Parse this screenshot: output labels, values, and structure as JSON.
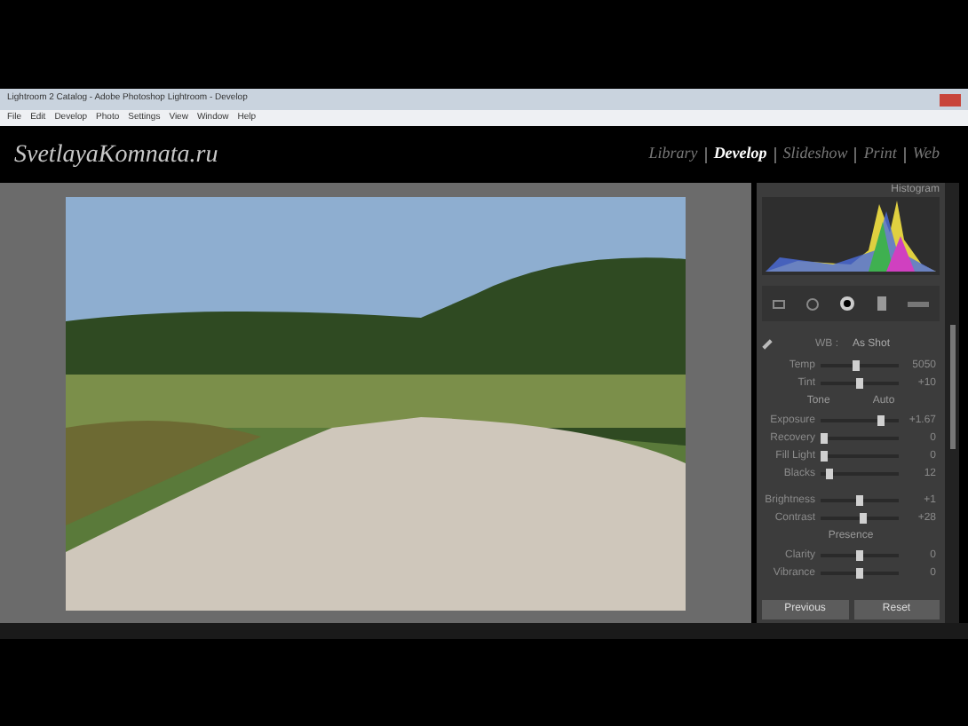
{
  "window": {
    "title": "Lightroom 2 Catalog - Adobe Photoshop Lightroom - Develop"
  },
  "menu": [
    "File",
    "Edit",
    "Develop",
    "Photo",
    "Settings",
    "View",
    "Window",
    "Help"
  ],
  "identity_plate": "SvetlayaKomnata.ru",
  "modules": [
    {
      "label": "Library",
      "selected": false
    },
    {
      "label": "Develop",
      "selected": true
    },
    {
      "label": "Slideshow",
      "selected": false
    },
    {
      "label": "Print",
      "selected": false
    },
    {
      "label": "Web",
      "selected": false
    }
  ],
  "histogram": {
    "title": "Histogram"
  },
  "basic": {
    "wb_label": "WB :",
    "wb_value": "As Shot",
    "sliders": [
      {
        "kind": "slider",
        "label": "Temp",
        "level": 0.45,
        "reading": "5050"
      },
      {
        "kind": "slider",
        "label": "Tint",
        "level": 0.5,
        "reading": "+10"
      },
      {
        "kind": "header",
        "label": "Tone",
        "action": "Auto"
      },
      {
        "kind": "slider",
        "label": "Exposure",
        "level": 0.78,
        "reading": "+1.67"
      },
      {
        "kind": "slider",
        "label": "Recovery",
        "level": 0.05,
        "reading": "0"
      },
      {
        "kind": "slider",
        "label": "Fill Light",
        "level": 0.05,
        "reading": "0"
      },
      {
        "kind": "slider",
        "label": "Blacks",
        "level": 0.12,
        "reading": "12"
      },
      {
        "kind": "gap"
      },
      {
        "kind": "slider",
        "label": "Brightness",
        "level": 0.5,
        "reading": "+1"
      },
      {
        "kind": "slider",
        "label": "Contrast",
        "level": 0.55,
        "reading": "+28"
      },
      {
        "kind": "header",
        "label": "Presence"
      },
      {
        "kind": "slider",
        "label": "Clarity",
        "level": 0.5,
        "reading": "0"
      },
      {
        "kind": "slider",
        "label": "Vibrance",
        "level": 0.5,
        "reading": "0"
      }
    ]
  },
  "buttons": [
    "Previous",
    "Reset"
  ]
}
